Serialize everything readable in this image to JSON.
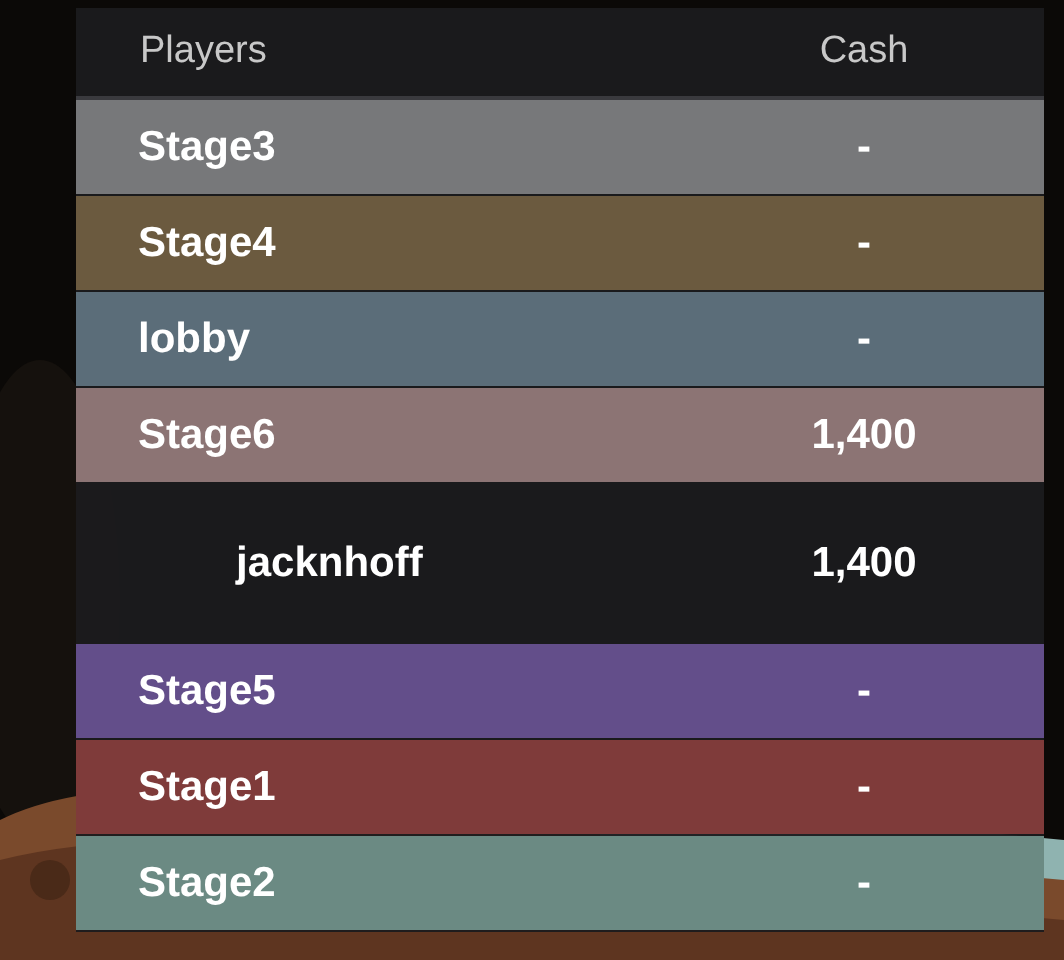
{
  "leaderboard": {
    "columns": [
      "Players",
      "Cash"
    ],
    "rows": [
      {
        "kind": "team",
        "name": "Stage3",
        "cash": "-",
        "color": "#77787a"
      },
      {
        "kind": "team",
        "name": "Stage4",
        "cash": "-",
        "color": "#6b5a3f"
      },
      {
        "kind": "team",
        "name": "lobby",
        "cash": "-",
        "color": "#5b6d79"
      },
      {
        "kind": "team",
        "name": "Stage6",
        "cash": "1,400",
        "color": "#8c7474"
      },
      {
        "kind": "player",
        "name": "jacknhoff",
        "cash": "1,400"
      },
      {
        "kind": "team",
        "name": "Stage5",
        "cash": "-",
        "color": "#634e8a"
      },
      {
        "kind": "team",
        "name": "Stage1",
        "cash": "-",
        "color": "#7f3b3a"
      },
      {
        "kind": "team",
        "name": "Stage2",
        "cash": "-",
        "color": "#6b8a83"
      }
    ]
  }
}
